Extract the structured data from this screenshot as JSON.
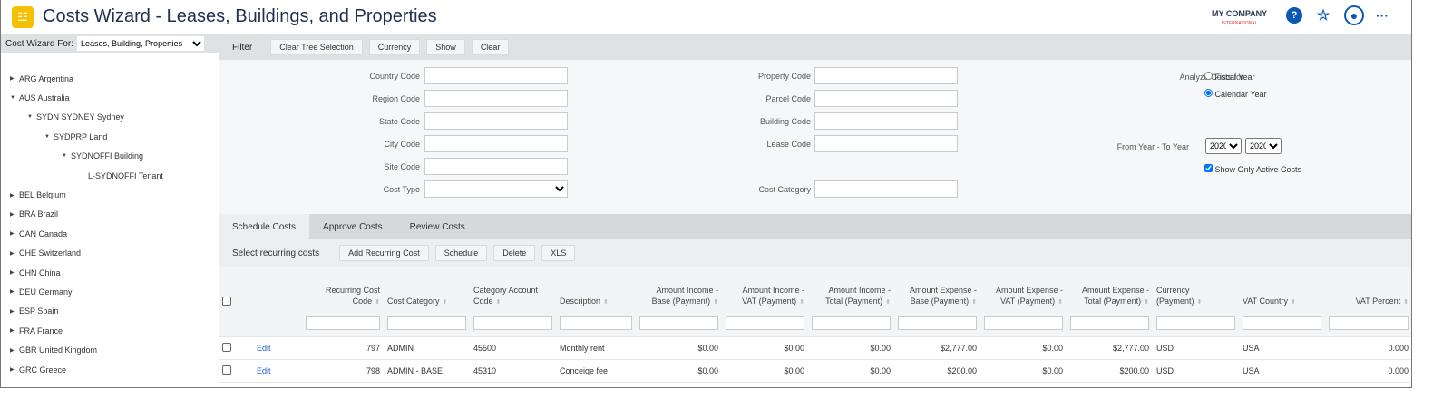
{
  "header": {
    "title": "Costs Wizard - Leases, Buildings, and Properties",
    "company": "MY COMPANY",
    "company_sub": "INTERNATIONAL",
    "icons": [
      "database-icon",
      "help-icon",
      "favorite-add-icon",
      "user-avatar-icon",
      "more-icon"
    ]
  },
  "left": {
    "label": "Cost Wizard For:",
    "selected": "Leases, Building, Properties",
    "tree": [
      {
        "label": "ARG Argentina",
        "level": 0,
        "expanded": false
      },
      {
        "label": "AUS Australia",
        "level": 0,
        "expanded": true
      },
      {
        "label": "SYDN SYDNEY Sydney",
        "level": 1,
        "expanded": true
      },
      {
        "label": "SYDPRP Land",
        "level": 2,
        "expanded": true
      },
      {
        "label": "SYDNOFFI Building",
        "level": 3,
        "expanded": true
      },
      {
        "label": "L-SYDNOFFI Tenant",
        "level": 4,
        "leaf": true
      },
      {
        "label": "BEL Belgium",
        "level": 0
      },
      {
        "label": "BRA Brazil",
        "level": 0
      },
      {
        "label": "CAN Canada",
        "level": 0
      },
      {
        "label": "CHE Switzerland",
        "level": 0
      },
      {
        "label": "CHN China",
        "level": 0
      },
      {
        "label": "DEU Germany",
        "level": 0
      },
      {
        "label": "ESP Spain",
        "level": 0
      },
      {
        "label": "FRA France",
        "level": 0
      },
      {
        "label": "GBR United Kingdom",
        "level": 0
      },
      {
        "label": "GRC Greece",
        "level": 0
      }
    ]
  },
  "filter": {
    "label": "Filter",
    "buttons": [
      "Clear Tree Selection",
      "Currency",
      "Show",
      "Clear"
    ],
    "col1": [
      "Country Code",
      "Region Code",
      "State Code",
      "City Code",
      "Site Code",
      "Cost Type"
    ],
    "col2": [
      "Property Code",
      "Parcel Code",
      "Building Code",
      "Lease Code",
      "Cost Category"
    ],
    "analyze_label": "Analyze Costs for",
    "fiscal": "Fiscal Year",
    "calendar": "Calendar Year",
    "selected_period": "Calendar Year",
    "year_label": "From Year - To Year",
    "from_year": "2020",
    "to_year": "2020",
    "active_only": "Show Only Active Costs",
    "active_only_checked": true
  },
  "tabs": [
    {
      "label": "Schedule Costs",
      "active": true
    },
    {
      "label": "Approve Costs"
    },
    {
      "label": "Review Costs"
    }
  ],
  "toolbar": {
    "label": "Select recurring costs",
    "buttons": [
      "Add Recurring Cost",
      "Schedule",
      "Delete",
      "XLS"
    ]
  },
  "table": {
    "columns": [
      "Recurring Cost Code",
      "Cost Category",
      "Category Account Code",
      "Description",
      "Amount Income - Base (Payment)",
      "Amount Income - VAT (Payment)",
      "Amount Income - Total (Payment)",
      "Amount Expense - Base (Payment)",
      "Amount Expense - VAT (Payment)",
      "Amount Expense - Total (Payment)",
      "Currency (Payment)",
      "VAT Country",
      "VAT Percent"
    ],
    "edit_label": "Edit",
    "rows": [
      [
        "797",
        "ADMIN",
        "45500",
        "Monthly rent",
        "$0.00",
        "$0.00",
        "$0.00",
        "$2,777.00",
        "$0.00",
        "$2,777.00",
        "USD",
        "USA",
        "0.000"
      ],
      [
        "798",
        "ADMIN - BASE",
        "45310",
        "Conceige fee",
        "$0.00",
        "$0.00",
        "$0.00",
        "$200.00",
        "$0.00",
        "$200.00",
        "USD",
        "USA",
        "0.000"
      ]
    ]
  },
  "colors": {
    "accent": "#f5c000",
    "link": "#1a5fd1",
    "icon_blue": "#0a57b5",
    "bar": "#dfe2e5"
  }
}
